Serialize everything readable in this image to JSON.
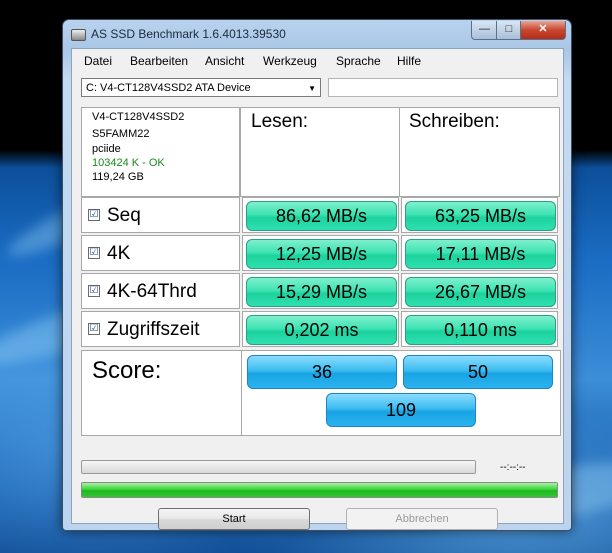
{
  "window": {
    "title": "AS SSD Benchmark 1.6.4013.39530",
    "min_glyph": "—",
    "max_glyph": "□",
    "close_glyph": "✕"
  },
  "menu": [
    "Datei",
    "Bearbeiten",
    "Ansicht",
    "Werkzeug",
    "Sprache",
    "Hilfe"
  ],
  "device": {
    "selected": "C: V4-CT128V4SSD2 ATA Device",
    "arrow": "▼"
  },
  "info": {
    "model": "V4-CT128V4SSD2",
    "firmware": "S5FAMM22",
    "driver": "pciide",
    "alignment": "103424 K - OK",
    "size": "119,24 GB"
  },
  "headers": {
    "read": "Lesen:",
    "write": "Schreiben:"
  },
  "rows": [
    {
      "label": "Seq",
      "checked": "☑",
      "read": "86,62 MB/s",
      "write": "63,25 MB/s"
    },
    {
      "label": "4K",
      "checked": "☑",
      "read": "12,25 MB/s",
      "write": "17,11 MB/s"
    },
    {
      "label": "4K-64Thrd",
      "checked": "☑",
      "read": "15,29 MB/s",
      "write": "26,67 MB/s"
    },
    {
      "label": "Zugriffszeit",
      "checked": "☑",
      "read": "0,202 ms",
      "write": "0,110 ms"
    }
  ],
  "score": {
    "label": "Score:",
    "read": "36",
    "write": "50",
    "total": "109"
  },
  "progress": {
    "elapsed": "--:--:--",
    "overall_fraction": 1.0
  },
  "buttons": {
    "start": "Start",
    "abort": "Abbrechen"
  },
  "colors": {
    "result_green": "#2ee0ae",
    "score_blue": "#2cb3ee",
    "progress_green": "#33c833"
  }
}
